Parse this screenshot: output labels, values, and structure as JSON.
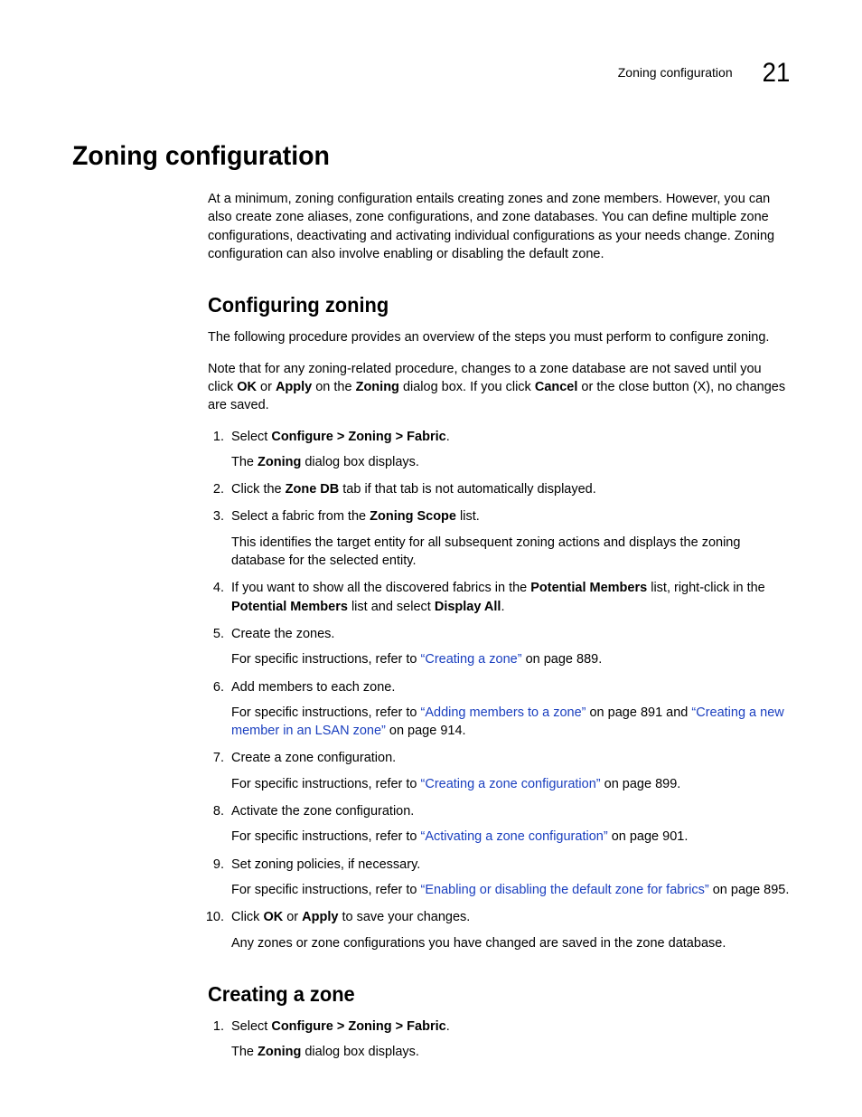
{
  "header": {
    "running_title": "Zoning configuration",
    "chapter_number": "21"
  },
  "title": "Zoning configuration",
  "intro": "At a minimum, zoning configuration entails creating zones and zone members. However, you can also create zone aliases, zone configurations, and zone databases. You can define multiple zone configurations, deactivating and activating individual configurations as your needs change. Zoning configuration can also involve enabling or disabling the default zone.",
  "section1": {
    "heading": "Configuring zoning",
    "p1": "The following procedure provides an overview of the steps you must perform to configure zoning.",
    "p2_a": "Note that for any zoning-related procedure, changes to a zone database are not saved until you click ",
    "p2_ok": "OK",
    "p2_b": " or ",
    "p2_apply": "Apply",
    "p2_c": " on the ",
    "p2_zoning": "Zoning",
    "p2_d": " dialog box. If you click ",
    "p2_cancel": "Cancel",
    "p2_e": " or the close button (X), no changes are saved.",
    "steps": {
      "s1a": "Select ",
      "s1b": "Configure > Zoning > Fabric",
      "s1c": ".",
      "s1sub_a": "The ",
      "s1sub_b": "Zoning",
      "s1sub_c": " dialog box displays.",
      "s2a": "Click the ",
      "s2b": "Zone DB",
      "s2c": " tab if that tab is not automatically displayed.",
      "s3a": "Select a fabric from the ",
      "s3b": "Zoning Scope",
      "s3c": " list.",
      "s3sub": "This identifies the target entity for all subsequent zoning actions and displays the zoning database for the selected entity.",
      "s4a": "If you want to show all the discovered fabrics in the ",
      "s4b": "Potential Members",
      "s4c": " list, right-click in the ",
      "s4d": "Potential Members",
      "s4e": " list and select ",
      "s4f": "Display All",
      "s4g": ".",
      "s5": "Create the zones.",
      "s5sub_a": "For specific instructions, refer to ",
      "s5link": "“Creating a zone”",
      "s5sub_b": " on page 889.",
      "s6": "Add members to each zone.",
      "s6sub_a": "For specific instructions, refer to ",
      "s6link1": "“Adding members to a zone”",
      "s6sub_b": " on page 891 and ",
      "s6link2": "“Creating a new member in an LSAN zone”",
      "s6sub_c": " on page 914.",
      "s7": "Create a zone configuration.",
      "s7sub_a": "For specific instructions, refer to ",
      "s7link": "“Creating a zone configuration”",
      "s7sub_b": " on page 899.",
      "s8": "Activate the zone configuration.",
      "s8sub_a": "For specific instructions, refer to ",
      "s8link": "“Activating a zone configuration”",
      "s8sub_b": " on page 901.",
      "s9": "Set zoning policies, if necessary.",
      "s9sub_a": "For specific instructions, refer to ",
      "s9link": "“Enabling or disabling the default zone for fabrics”",
      "s9sub_b": " on page 895.",
      "s10a": "Click ",
      "s10b": "OK",
      "s10c": " or ",
      "s10d": "Apply",
      "s10e": " to save your changes.",
      "s10sub": "Any zones or zone configurations you have changed are saved in the zone database."
    }
  },
  "section2": {
    "heading": "Creating a zone",
    "steps": {
      "s1a": "Select ",
      "s1b": "Configure > Zoning > Fabric",
      "s1c": ".",
      "s1sub_a": "The ",
      "s1sub_b": "Zoning",
      "s1sub_c": " dialog box displays."
    }
  }
}
